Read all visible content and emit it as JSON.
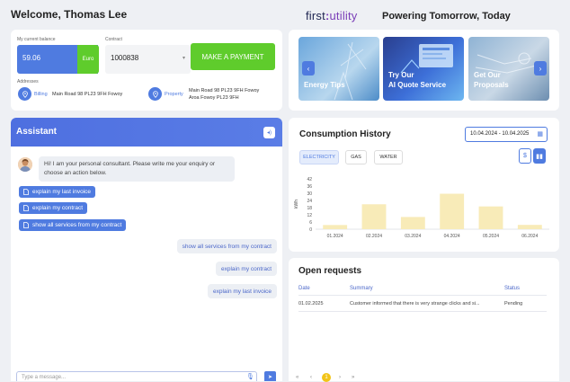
{
  "header": {
    "welcome": "Welcome, Thomas Lee",
    "logo_first": "first",
    "logo_sep": ":",
    "logo_utility": "utility",
    "tagline": "Powering Tomorrow, Today"
  },
  "account": {
    "balance_label": "My current balance",
    "balance_value": "59.06",
    "currency": "Euro",
    "contract_label": "Contract",
    "contract_value": "1000838",
    "pay_button": "MAKE A PAYMENT",
    "addresses_label": "Addresses",
    "billing_kind": "Billing",
    "billing_address": "Main Road 98 PL23 9FH Fowoy",
    "property_kind": "Property",
    "property_address_line1": "Main Road 98 PL23 9FH Fowoy",
    "property_address_line2": "Aroa Fowoy PL23 9FH"
  },
  "assistant": {
    "title": "Assistant",
    "greeting": "Hi! I am your personal consultant. Please write me your enquiry or choose an action below.",
    "chips": [
      "explain my last invoice",
      "explain my contract",
      "show all services from my contract"
    ],
    "user_messages": [
      "show all services from my contract",
      "explain my contract",
      "explain my last invoice"
    ],
    "input_placeholder": "Type a message..."
  },
  "banners": [
    {
      "line1": "",
      "line2": "Energy Tips"
    },
    {
      "line1": "Try Our",
      "line2": "AI Quote Service"
    },
    {
      "line1": "Get Our",
      "line2": "Proposals"
    }
  ],
  "consumption": {
    "title": "Consumption History",
    "date_range": "10.04.2024 - 10.04.2025",
    "tabs": [
      "ELECTRICITY",
      "GAS",
      "WATER"
    ],
    "active_tab": "ELECTRICITY",
    "toggle_currency": "$"
  },
  "chart_data": {
    "type": "bar",
    "ylabel": "kWh",
    "ylim": [
      0,
      42
    ],
    "yticks": [
      0,
      6,
      12,
      18,
      24,
      30,
      36,
      42
    ],
    "categories": [
      "01.2024",
      "02.2024",
      "03.2024",
      "04.2024",
      "05.2024",
      "06.2024"
    ],
    "values": [
      3.5,
      20.8,
      10.2,
      29.6,
      19.0,
      3.6
    ],
    "bar_labels": [
      "",
      "",
      "",
      "",
      "",
      ""
    ],
    "bar_color": "#f8ebb8",
    "grid": false
  },
  "requests": {
    "title": "Open requests",
    "columns": [
      "Date",
      "Summary",
      "Status"
    ],
    "rows": [
      {
        "date": "01.02.2025",
        "summary": "Customer informed that there is very strange clicks and si...",
        "status": "Pending"
      }
    ],
    "pager": [
      "«",
      "‹",
      "1",
      "›",
      "»"
    ]
  },
  "colors": {
    "accent": "#4f7be0",
    "green": "#5fcc2c",
    "brand_purple": "#7b3fb8"
  }
}
